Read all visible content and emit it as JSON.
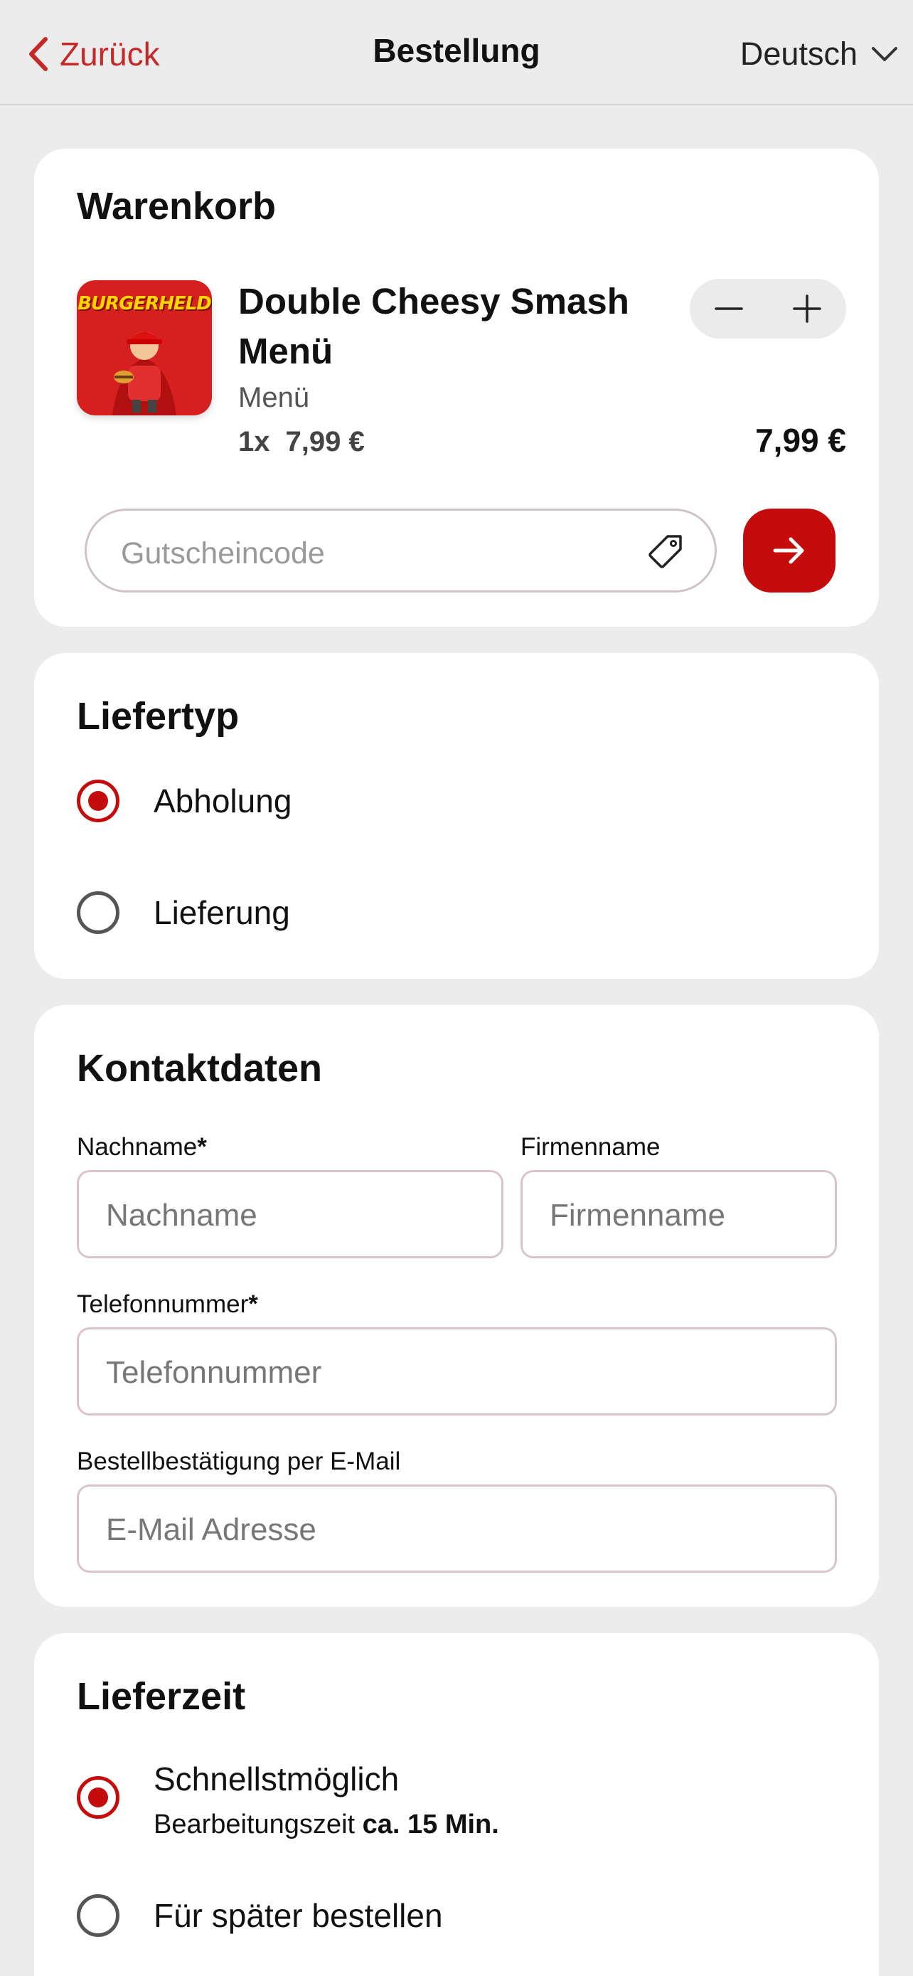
{
  "header": {
    "back_label": "Zurück",
    "title": "Bestellung",
    "language": "Deutsch"
  },
  "cart": {
    "heading": "Warenkorb",
    "item": {
      "image_text": "BURGERHELD",
      "name": "Double Cheesy Smash Menü",
      "category": "Menü",
      "quantity": "1x",
      "unit_price": "7,99 €",
      "total_price": "7,99 €"
    },
    "coupon": {
      "placeholder": "Gutscheincode"
    }
  },
  "delivery_type": {
    "heading": "Liefertyp",
    "options": [
      {
        "label": "Abholung",
        "selected": true
      },
      {
        "label": "Lieferung",
        "selected": false
      }
    ]
  },
  "contact": {
    "heading": "Kontaktdaten",
    "lastname_label": "Nachname",
    "lastname_placeholder": "Nachname",
    "company_label": "Firmenname",
    "company_placeholder": "Firmenname",
    "phone_label": "Telefonnummer",
    "phone_placeholder": "Telefonnummer",
    "email_label": "Bestellbestätigung per E-Mail",
    "email_placeholder": "E-Mail Adresse",
    "required_mark": "*"
  },
  "delivery_time": {
    "heading": "Lieferzeit",
    "options": [
      {
        "label": "Schnellstmöglich",
        "sub_prefix": "Bearbeitungszeit ",
        "sub_value": "ca. 15 Min.",
        "selected": true
      },
      {
        "label": "Für später bestellen",
        "selected": false
      }
    ]
  },
  "colors": {
    "accent": "#c40c0c",
    "background": "#ececec",
    "card": "#ffffff"
  }
}
